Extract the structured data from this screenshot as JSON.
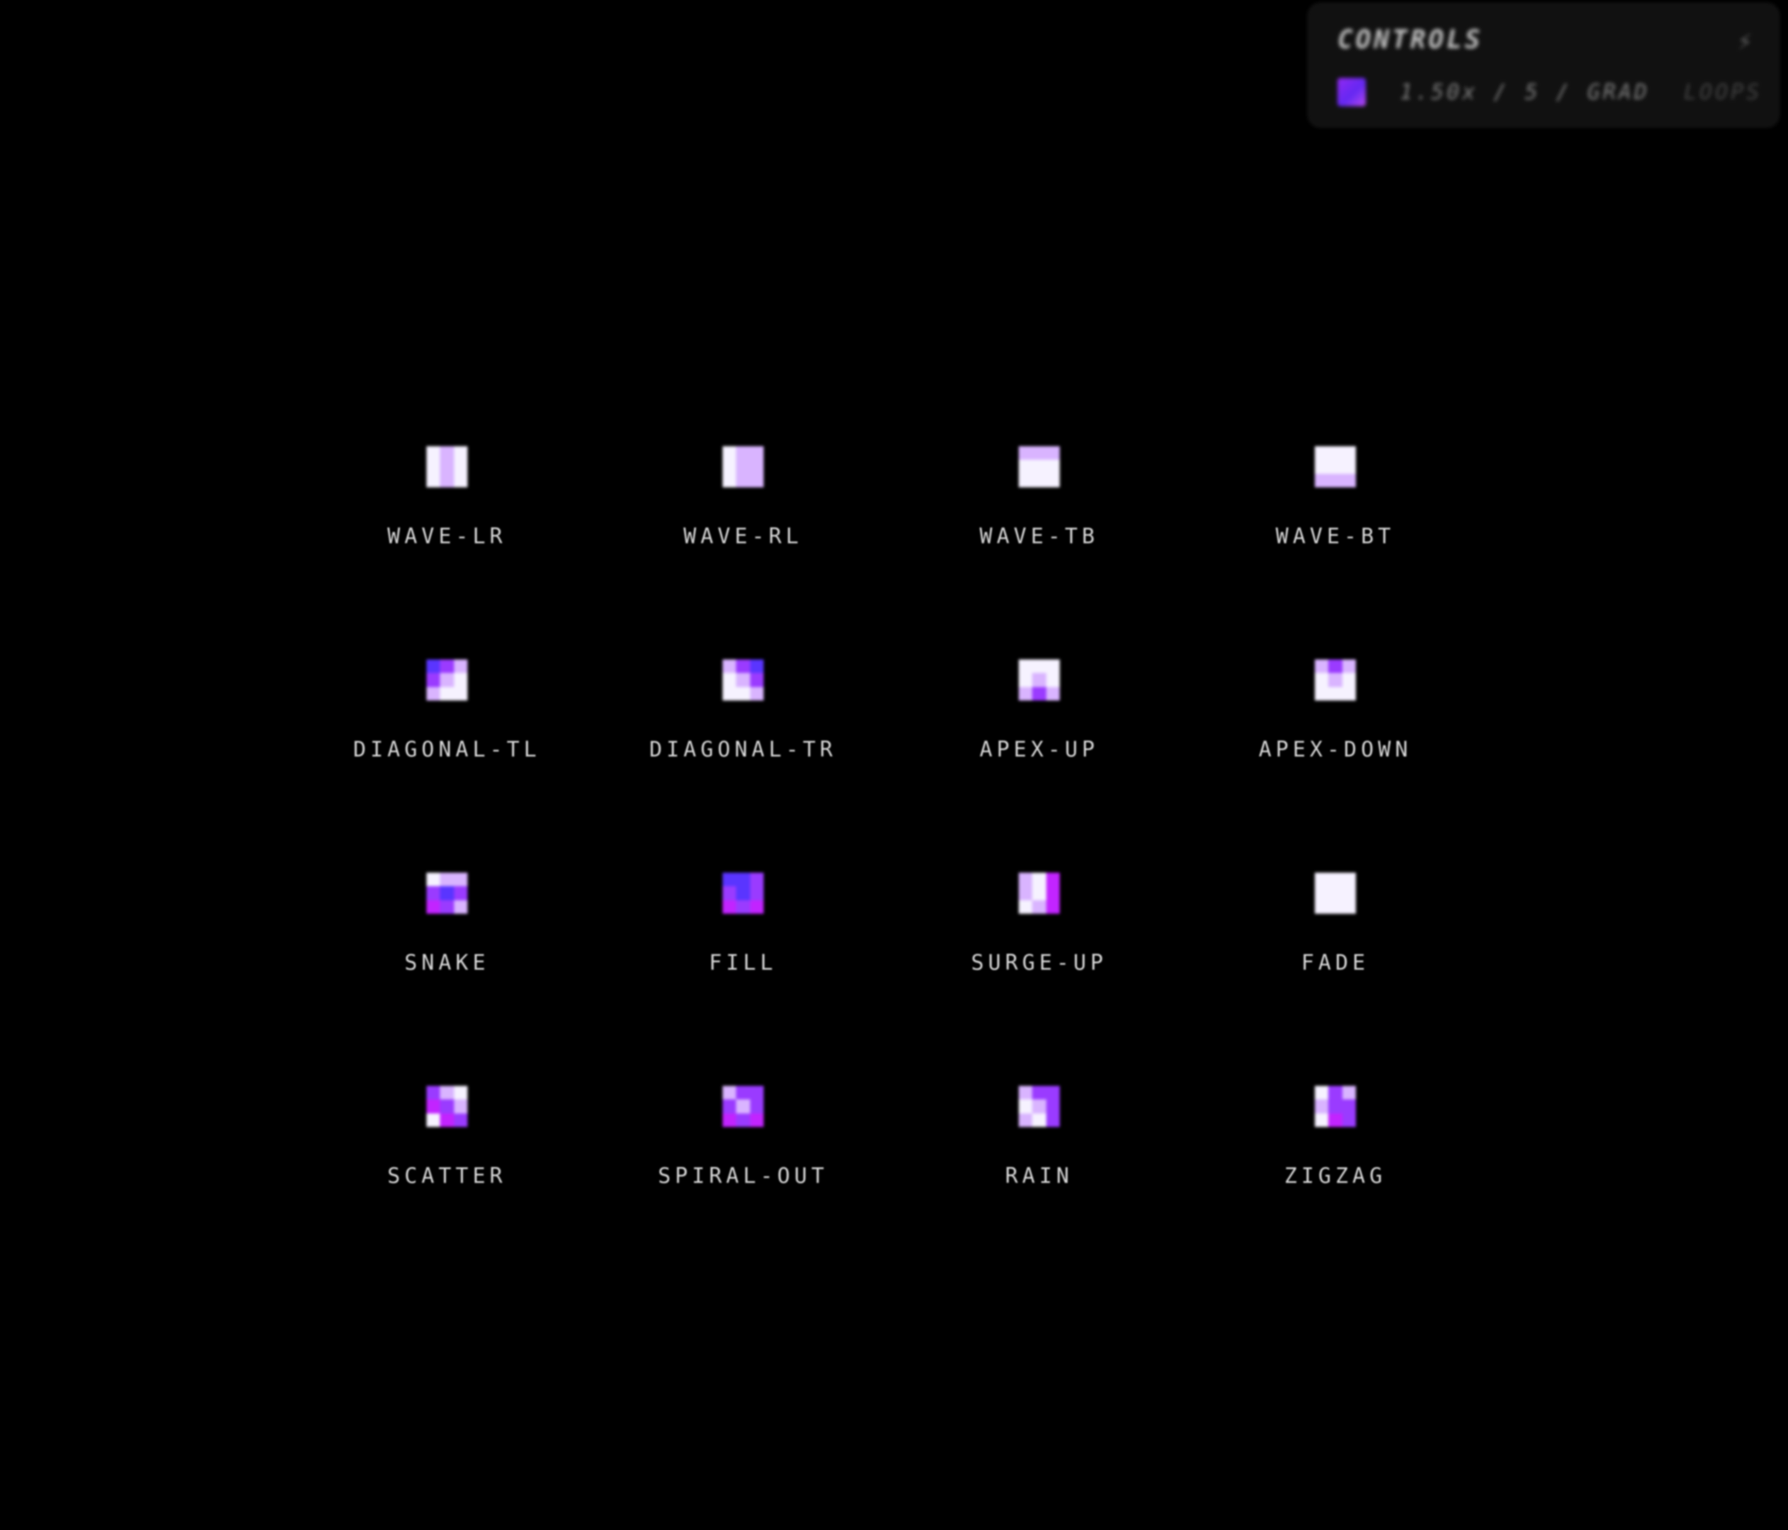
{
  "controls": {
    "title": "CONTROLS",
    "bolt_icon": "bolt-icon",
    "swatch_colors": [
      "#9b2cff",
      "#6a2bff",
      "#c24dff"
    ],
    "settings_text": "1.50x / 5 / GRAD",
    "sub_text": "LOOPS"
  },
  "colors": {
    "background": "#000000",
    "white": "#f6f2ff",
    "lilac": "#d9b4ff",
    "violet": "#9a3bff",
    "indigo": "#5a35ff",
    "magenta": "#c224ff"
  },
  "presets": [
    {
      "label": "WAVE-LR",
      "cells": [
        "W",
        "L",
        "W",
        "W",
        "L",
        "W",
        "W",
        "L",
        "W"
      ]
    },
    {
      "label": "WAVE-RL",
      "cells": [
        "W",
        "L",
        "L",
        "W",
        "L",
        "L",
        "W",
        "L",
        "L"
      ]
    },
    {
      "label": "WAVE-TB",
      "cells": [
        "L",
        "L",
        "L",
        "W",
        "W",
        "W",
        "W",
        "W",
        "W"
      ]
    },
    {
      "label": "WAVE-BT",
      "cells": [
        "W",
        "W",
        "W",
        "W",
        "W",
        "W",
        "L",
        "L",
        "L"
      ]
    },
    {
      "label": "DIAGONAL-TL",
      "cells": [
        "I",
        "V",
        "L",
        "V",
        "L",
        "W",
        "L",
        "W",
        "W"
      ]
    },
    {
      "label": "DIAGONAL-TR",
      "cells": [
        "L",
        "V",
        "I",
        "W",
        "L",
        "V",
        "W",
        "W",
        "L"
      ]
    },
    {
      "label": "APEX-UP",
      "cells": [
        "W",
        "W",
        "W",
        "W",
        "L",
        "W",
        "L",
        "V",
        "L"
      ]
    },
    {
      "label": "APEX-DOWN",
      "cells": [
        "L",
        "V",
        "L",
        "W",
        "L",
        "W",
        "W",
        "W",
        "W"
      ]
    },
    {
      "label": "SNAKE",
      "cells": [
        "W",
        "L",
        "L",
        "V",
        "I",
        "V",
        "M",
        "V",
        "L"
      ]
    },
    {
      "label": "FILL",
      "cells": [
        "I",
        "I",
        "V",
        "V",
        "I",
        "V",
        "M",
        "V",
        "M"
      ]
    },
    {
      "label": "SURGE-UP",
      "cells": [
        "L",
        "W",
        "M",
        "L",
        "W",
        "M",
        "W",
        "L",
        "M"
      ]
    },
    {
      "label": "FADE",
      "cells": [
        "W",
        "W",
        "W",
        "W",
        "W",
        "W",
        "W",
        "W",
        "W"
      ]
    },
    {
      "label": "SCATTER",
      "cells": [
        "V",
        "L",
        "W",
        "M",
        "V",
        "L",
        "W",
        "M",
        "V"
      ]
    },
    {
      "label": "SPIRAL-OUT",
      "cells": [
        "L",
        "V",
        "V",
        "V",
        "L",
        "V",
        "M",
        "V",
        "M"
      ]
    },
    {
      "label": "RAIN",
      "cells": [
        "L",
        "V",
        "V",
        "W",
        "L",
        "V",
        "L",
        "W",
        "V"
      ]
    },
    {
      "label": "ZIGZAG",
      "cells": [
        "W",
        "V",
        "L",
        "L",
        "V",
        "V",
        "W",
        "M",
        "V"
      ]
    }
  ]
}
